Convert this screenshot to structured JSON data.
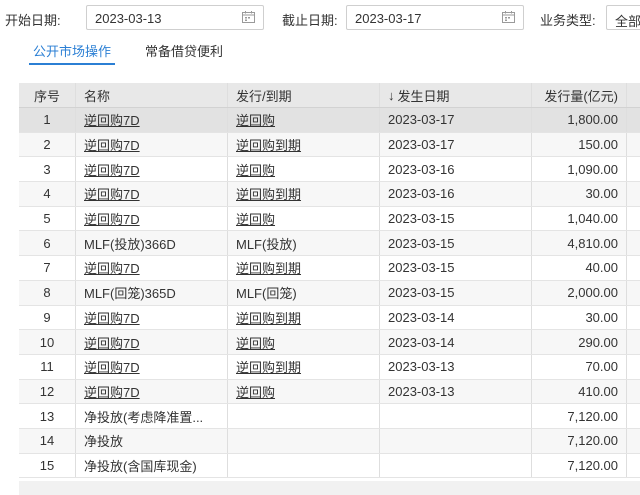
{
  "filters": {
    "start_label": "开始日期:",
    "start_value": "2023-03-13",
    "end_label": "截止日期:",
    "end_value": "2023-03-17",
    "type_label": "业务类型:",
    "type_value": "全部"
  },
  "tabs": [
    {
      "label": "公开市场操作",
      "active": true
    },
    {
      "label": "常备借贷便利",
      "active": false
    }
  ],
  "table": {
    "columns": [
      "序号",
      "名称",
      "发行/到期",
      "发生日期",
      "发行量(亿元)"
    ],
    "sort_indicator": "↓",
    "rows": [
      {
        "idx": "1",
        "name": "逆回购7D",
        "type": "逆回购",
        "date": "2023-03-17",
        "amount": "1,800.00",
        "link_name": true,
        "link_type": true
      },
      {
        "idx": "2",
        "name": "逆回购7D",
        "type": "逆回购到期",
        "date": "2023-03-17",
        "amount": "150.00",
        "link_name": true,
        "link_type": true
      },
      {
        "idx": "3",
        "name": "逆回购7D",
        "type": "逆回购",
        "date": "2023-03-16",
        "amount": "1,090.00",
        "link_name": true,
        "link_type": true
      },
      {
        "idx": "4",
        "name": "逆回购7D",
        "type": "逆回购到期",
        "date": "2023-03-16",
        "amount": "30.00",
        "link_name": true,
        "link_type": true
      },
      {
        "idx": "5",
        "name": "逆回购7D",
        "type": "逆回购",
        "date": "2023-03-15",
        "amount": "1,040.00",
        "link_name": true,
        "link_type": true
      },
      {
        "idx": "6",
        "name": "MLF(投放)366D",
        "type": "MLF(投放)",
        "date": "2023-03-15",
        "amount": "4,810.00",
        "link_name": false,
        "link_type": false
      },
      {
        "idx": "7",
        "name": "逆回购7D",
        "type": "逆回购到期",
        "date": "2023-03-15",
        "amount": "40.00",
        "link_name": true,
        "link_type": true
      },
      {
        "idx": "8",
        "name": "MLF(回笼)365D",
        "type": "MLF(回笼)",
        "date": "2023-03-15",
        "amount": "2,000.00",
        "link_name": false,
        "link_type": false
      },
      {
        "idx": "9",
        "name": "逆回购7D",
        "type": "逆回购到期",
        "date": "2023-03-14",
        "amount": "30.00",
        "link_name": true,
        "link_type": true
      },
      {
        "idx": "10",
        "name": "逆回购7D",
        "type": "逆回购",
        "date": "2023-03-14",
        "amount": "290.00",
        "link_name": true,
        "link_type": true
      },
      {
        "idx": "11",
        "name": "逆回购7D",
        "type": "逆回购到期",
        "date": "2023-03-13",
        "amount": "70.00",
        "link_name": true,
        "link_type": true
      },
      {
        "idx": "12",
        "name": "逆回购7D",
        "type": "逆回购",
        "date": "2023-03-13",
        "amount": "410.00",
        "link_name": true,
        "link_type": true
      },
      {
        "idx": "13",
        "name": "净投放(考虑降准置...",
        "type": "",
        "date": "",
        "amount": "7,120.00",
        "link_name": false,
        "link_type": false
      },
      {
        "idx": "14",
        "name": "净投放",
        "type": "",
        "date": "",
        "amount": "7,120.00",
        "link_name": false,
        "link_type": false
      },
      {
        "idx": "15",
        "name": "净投放(含国库现金)",
        "type": "",
        "date": "",
        "amount": "7,120.00",
        "link_name": false,
        "link_type": false
      }
    ]
  },
  "colors": {
    "accent": "#2b7fd4",
    "header_bg": "#e8e8e8",
    "row_alt": "#f7f7f7"
  }
}
